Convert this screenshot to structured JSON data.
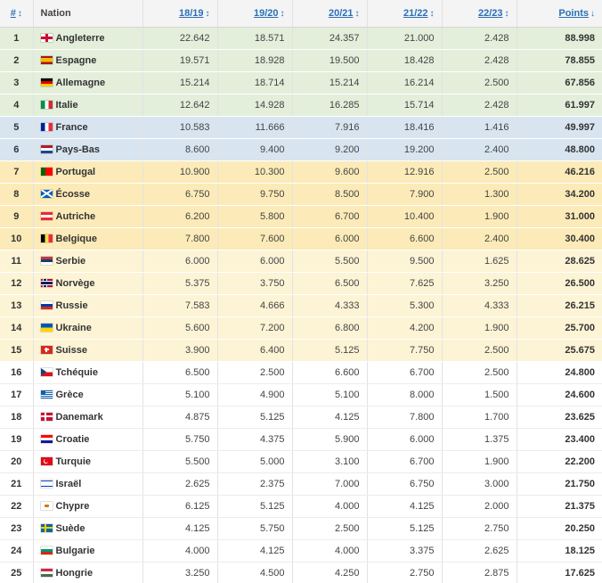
{
  "header": {
    "rank": "#",
    "nation": "Nation",
    "season_1": "18/19",
    "season_2": "19/20",
    "season_3": "20/21",
    "season_4": "21/22",
    "season_5": "22/23",
    "points": "Points",
    "sort_both_glyph": "↕",
    "sort_desc_glyph": "↓"
  },
  "rows": [
    {
      "rank": "1",
      "flag": "f-eng",
      "flag_icon": "england-flag-icon",
      "nation": "Angleterre",
      "s1": "22.642",
      "s2": "18.571",
      "s3": "24.357",
      "s4": "21.000",
      "s5": "2.428",
      "points": "88.998",
      "zone": "z-green"
    },
    {
      "rank": "2",
      "flag": "f-esp",
      "flag_icon": "spain-flag-icon",
      "nation": "Espagne",
      "s1": "19.571",
      "s2": "18.928",
      "s3": "19.500",
      "s4": "18.428",
      "s5": "2.428",
      "points": "78.855",
      "zone": "z-green"
    },
    {
      "rank": "3",
      "flag": "f-ger",
      "flag_icon": "germany-flag-icon",
      "nation": "Allemagne",
      "s1": "15.214",
      "s2": "18.714",
      "s3": "15.214",
      "s4": "16.214",
      "s5": "2.500",
      "points": "67.856",
      "zone": "z-green"
    },
    {
      "rank": "4",
      "flag": "f-ita",
      "flag_icon": "italy-flag-icon",
      "nation": "Italie",
      "s1": "12.642",
      "s2": "14.928",
      "s3": "16.285",
      "s4": "15.714",
      "s5": "2.428",
      "points": "61.997",
      "zone": "z-green"
    },
    {
      "rank": "5",
      "flag": "f-fra",
      "flag_icon": "france-flag-icon",
      "nation": "France",
      "s1": "10.583",
      "s2": "11.666",
      "s3": "7.916",
      "s4": "18.416",
      "s5": "1.416",
      "points": "49.997",
      "zone": "z-blue"
    },
    {
      "rank": "6",
      "flag": "f-ned",
      "flag_icon": "netherlands-flag-icon",
      "nation": "Pays-Bas",
      "s1": "8.600",
      "s2": "9.400",
      "s3": "9.200",
      "s4": "19.200",
      "s5": "2.400",
      "points": "48.800",
      "zone": "z-blue"
    },
    {
      "rank": "7",
      "flag": "f-por",
      "flag_icon": "portugal-flag-icon",
      "nation": "Portugal",
      "s1": "10.900",
      "s2": "10.300",
      "s3": "9.600",
      "s4": "12.916",
      "s5": "2.500",
      "points": "46.216",
      "zone": "z-orange"
    },
    {
      "rank": "8",
      "flag": "f-sco",
      "flag_icon": "scotland-flag-icon",
      "nation": "Écosse",
      "s1": "6.750",
      "s2": "9.750",
      "s3": "8.500",
      "s4": "7.900",
      "s5": "1.300",
      "points": "34.200",
      "zone": "z-orange"
    },
    {
      "rank": "9",
      "flag": "f-aut",
      "flag_icon": "austria-flag-icon",
      "nation": "Autriche",
      "s1": "6.200",
      "s2": "5.800",
      "s3": "6.700",
      "s4": "10.400",
      "s5": "1.900",
      "points": "31.000",
      "zone": "z-orange"
    },
    {
      "rank": "10",
      "flag": "f-bel",
      "flag_icon": "belgium-flag-icon",
      "nation": "Belgique",
      "s1": "7.800",
      "s2": "7.600",
      "s3": "6.000",
      "s4": "6.600",
      "s5": "2.400",
      "points": "30.400",
      "zone": "z-orange"
    },
    {
      "rank": "11",
      "flag": "f-srb",
      "flag_icon": "serbia-flag-icon",
      "nation": "Serbie",
      "s1": "6.000",
      "s2": "6.000",
      "s3": "5.500",
      "s4": "9.500",
      "s5": "1.625",
      "points": "28.625",
      "zone": "z-yellow"
    },
    {
      "rank": "12",
      "flag": "f-nor",
      "flag_icon": "norway-flag-icon",
      "nation": "Norvège",
      "s1": "5.375",
      "s2": "3.750",
      "s3": "6.500",
      "s4": "7.625",
      "s5": "3.250",
      "points": "26.500",
      "zone": "z-yellow"
    },
    {
      "rank": "13",
      "flag": "f-rus",
      "flag_icon": "russia-flag-icon",
      "nation": "Russie",
      "s1": "7.583",
      "s2": "4.666",
      "s3": "4.333",
      "s4": "5.300",
      "s5": "4.333",
      "points": "26.215",
      "zone": "z-yellow"
    },
    {
      "rank": "14",
      "flag": "f-ukr",
      "flag_icon": "ukraine-flag-icon",
      "nation": "Ukraine",
      "s1": "5.600",
      "s2": "7.200",
      "s3": "6.800",
      "s4": "4.200",
      "s5": "1.900",
      "points": "25.700",
      "zone": "z-yellow"
    },
    {
      "rank": "15",
      "flag": "f-sui",
      "flag_icon": "switzerland-flag-icon",
      "nation": "Suisse",
      "s1": "3.900",
      "s2": "6.400",
      "s3": "5.125",
      "s4": "7.750",
      "s5": "2.500",
      "points": "25.675",
      "zone": "z-yellow"
    },
    {
      "rank": "16",
      "flag": "f-cze",
      "flag_icon": "czechia-flag-icon",
      "nation": "Tchéquie",
      "s1": "6.500",
      "s2": "2.500",
      "s3": "6.600",
      "s4": "6.700",
      "s5": "2.500",
      "points": "24.800",
      "zone": "z-white"
    },
    {
      "rank": "17",
      "flag": "f-gre",
      "flag_icon": "greece-flag-icon",
      "nation": "Grèce",
      "s1": "5.100",
      "s2": "4.900",
      "s3": "5.100",
      "s4": "8.000",
      "s5": "1.500",
      "points": "24.600",
      "zone": "z-white"
    },
    {
      "rank": "18",
      "flag": "f-den",
      "flag_icon": "denmark-flag-icon",
      "nation": "Danemark",
      "s1": "4.875",
      "s2": "5.125",
      "s3": "4.125",
      "s4": "7.800",
      "s5": "1.700",
      "points": "23.625",
      "zone": "z-white"
    },
    {
      "rank": "19",
      "flag": "f-cro",
      "flag_icon": "croatia-flag-icon",
      "nation": "Croatie",
      "s1": "5.750",
      "s2": "4.375",
      "s3": "5.900",
      "s4": "6.000",
      "s5": "1.375",
      "points": "23.400",
      "zone": "z-white"
    },
    {
      "rank": "20",
      "flag": "f-tur",
      "flag_icon": "turkey-flag-icon",
      "nation": "Turquie",
      "s1": "5.500",
      "s2": "5.000",
      "s3": "3.100",
      "s4": "6.700",
      "s5": "1.900",
      "points": "22.200",
      "zone": "z-white"
    },
    {
      "rank": "21",
      "flag": "f-isr",
      "flag_icon": "israel-flag-icon",
      "nation": "Israël",
      "s1": "2.625",
      "s2": "2.375",
      "s3": "7.000",
      "s4": "6.750",
      "s5": "3.000",
      "points": "21.750",
      "zone": "z-white"
    },
    {
      "rank": "22",
      "flag": "f-cyp",
      "flag_icon": "cyprus-flag-icon",
      "nation": "Chypre",
      "s1": "6.125",
      "s2": "5.125",
      "s3": "4.000",
      "s4": "4.125",
      "s5": "2.000",
      "points": "21.375",
      "zone": "z-white"
    },
    {
      "rank": "23",
      "flag": "f-swe",
      "flag_icon": "sweden-flag-icon",
      "nation": "Suède",
      "s1": "4.125",
      "s2": "5.750",
      "s3": "2.500",
      "s4": "5.125",
      "s5": "2.750",
      "points": "20.250",
      "zone": "z-white"
    },
    {
      "rank": "24",
      "flag": "f-bul",
      "flag_icon": "bulgaria-flag-icon",
      "nation": "Bulgarie",
      "s1": "4.000",
      "s2": "4.125",
      "s3": "4.000",
      "s4": "3.375",
      "s5": "2.625",
      "points": "18.125",
      "zone": "z-white"
    },
    {
      "rank": "25",
      "flag": "f-hun",
      "flag_icon": "hungary-flag-icon",
      "nation": "Hongrie",
      "s1": "3.250",
      "s2": "4.500",
      "s3": "4.250",
      "s4": "2.750",
      "s5": "2.875",
      "points": "17.625",
      "zone": "z-white"
    }
  ],
  "colors": {
    "header_bg": "#f4f4f4",
    "link": "#2a6fb8",
    "zone_green": "#e3eedb",
    "zone_blue": "#d8e5f0",
    "zone_orange": "#fcebb8",
    "zone_yellow": "#fdf4d6",
    "zone_white": "#ffffff"
  }
}
